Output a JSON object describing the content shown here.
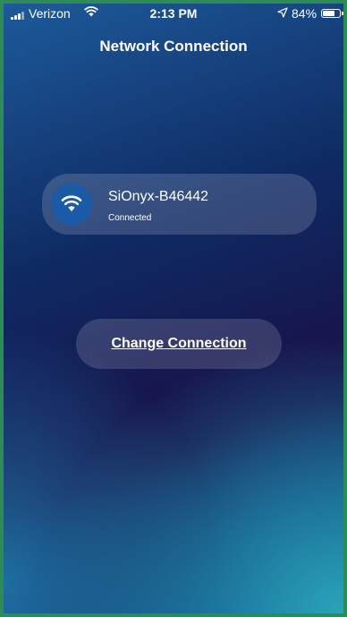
{
  "status_bar": {
    "carrier": "Verizon",
    "time": "2:13 PM",
    "battery_percent_text": "84%",
    "battery_level": 0.84,
    "icons": [
      "signal-icon",
      "wifi-icon",
      "location-arrow-icon",
      "battery-icon"
    ]
  },
  "header": {
    "title": "Network Connection"
  },
  "network": {
    "name": "SiOnyx-B46442",
    "status": "Connected",
    "icon": "wifi-icon"
  },
  "actions": {
    "change_connection_label": "Change Connection"
  },
  "colors": {
    "frame_border": "#2e8b57",
    "wifi_badge": "#1b5aa6",
    "text": "#ffffff"
  }
}
